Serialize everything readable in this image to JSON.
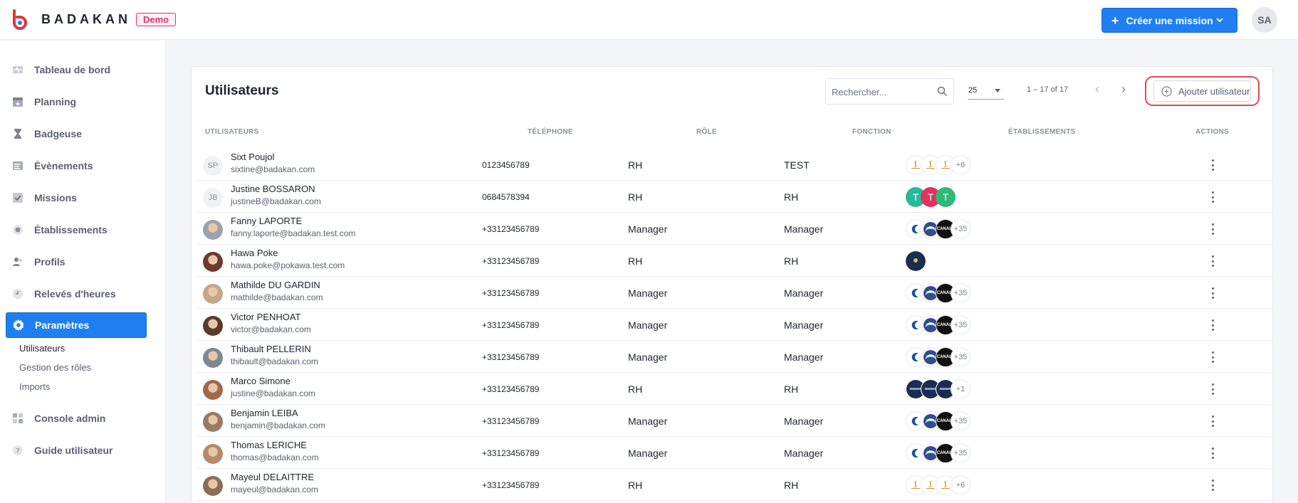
{
  "header": {
    "logo_text": "BADAKAN",
    "demo_badge": "Demo",
    "create_button": "Créer une mission",
    "user_initials": "SA",
    "brand_color": "#1f7ff0"
  },
  "sidebar": {
    "items": [
      {
        "label": "Tableau de bord",
        "icon": "pulse-icon"
      },
      {
        "label": "Planning",
        "icon": "calendar-icon"
      },
      {
        "label": "Badgeuse",
        "icon": "hourglass-icon"
      },
      {
        "label": "Évènements",
        "icon": "list-icon"
      },
      {
        "label": "Missions",
        "icon": "checkbox-icon"
      },
      {
        "label": "Établissements",
        "icon": "building-icon"
      },
      {
        "label": "Profils",
        "icon": "users-icon"
      },
      {
        "label": "Relevés d'heures",
        "icon": "clock-icon"
      },
      {
        "label": "Paramètres",
        "icon": "gear-icon"
      },
      {
        "label": "Console admin",
        "icon": "grid-icon"
      },
      {
        "label": "Guide utilisateur",
        "icon": "help-icon"
      }
    ],
    "sub_items": [
      "Utilisateurs",
      "Gestion des rôles",
      "Imports"
    ]
  },
  "card": {
    "title": "Utilisateurs",
    "search_placeholder": "Rechercher...",
    "page_size": "25",
    "range": "1 – 17 of 17",
    "add_button": "Ajouter utilisateur"
  },
  "table": {
    "headers": [
      "UTILISATEURS",
      "TÉLÉPHONE",
      "RÔLE",
      "FONCTION",
      "ÉTABLISSEMENTS",
      "ACTIONS"
    ],
    "rows": [
      {
        "name": "Sixt Poujol",
        "email": "sixtine@badakan.com",
        "initials": "SP",
        "phone": "0123456789",
        "role": "RH",
        "function": "TEST",
        "estab_type": "gold",
        "more": "+6"
      },
      {
        "name": "Justine BOSSARON",
        "email": "justineB@badakan.com",
        "initials": "JB",
        "phone": "0684578394",
        "role": "RH",
        "function": "RH",
        "estab_type": "letters",
        "more": ""
      },
      {
        "name": "Fanny LAPORTE",
        "email": "fanny.laporte@badakan.test.com",
        "initials": "",
        "phone": "+33123456789",
        "role": "Manager",
        "function": "Manager",
        "estab_type": "blue",
        "more": "+35"
      },
      {
        "name": "Hawa Poke",
        "email": "hawa.poke@pokawa.test.com",
        "initials": "",
        "phone": "+33123456789",
        "role": "RH",
        "function": "RH",
        "estab_type": "single",
        "more": ""
      },
      {
        "name": "Mathilde DU GARDIN",
        "email": "mathilde@badakan.com",
        "initials": "",
        "phone": "+33123456789",
        "role": "Manager",
        "function": "Manager",
        "estab_type": "blue",
        "more": "+35"
      },
      {
        "name": "Victor PENHOAT",
        "email": "victor@badakan.com",
        "initials": "",
        "phone": "+33123456789",
        "role": "Manager",
        "function": "Manager",
        "estab_type": "blue",
        "more": "+35"
      },
      {
        "name": "Thibault PELLERIN",
        "email": "thibault@badakan.com",
        "initials": "",
        "phone": "+33123456789",
        "role": "Manager",
        "function": "Manager",
        "estab_type": "blue",
        "more": "+35"
      },
      {
        "name": "Marco Simone",
        "email": "justine@badakan.com",
        "initials": "",
        "phone": "+33123456789",
        "role": "RH",
        "function": "RH",
        "estab_type": "navy",
        "more": "+1"
      },
      {
        "name": "Benjamin LEIBA",
        "email": "benjamin@badakan.com",
        "initials": "",
        "phone": "+33123456789",
        "role": "Manager",
        "function": "Manager",
        "estab_type": "blue",
        "more": "+35"
      },
      {
        "name": "Thomas LERICHE",
        "email": "thomas@badakan.com",
        "initials": "",
        "phone": "+33123456789",
        "role": "Manager",
        "function": "Manager",
        "estab_type": "blue",
        "more": "+35"
      },
      {
        "name": "Mayeul DELAITTRE",
        "email": "mayeul@badakan.com",
        "initials": "",
        "phone": "+33123456789",
        "role": "RH",
        "function": "RH",
        "estab_type": "gold",
        "more": "+6"
      }
    ],
    "letter_estabs": [
      {
        "letter": "T",
        "color": "#26b99a"
      },
      {
        "letter": "T",
        "color": "#e0335f"
      },
      {
        "letter": "T",
        "color": "#2fb97a"
      }
    ],
    "canal_text": "CANAL+"
  }
}
